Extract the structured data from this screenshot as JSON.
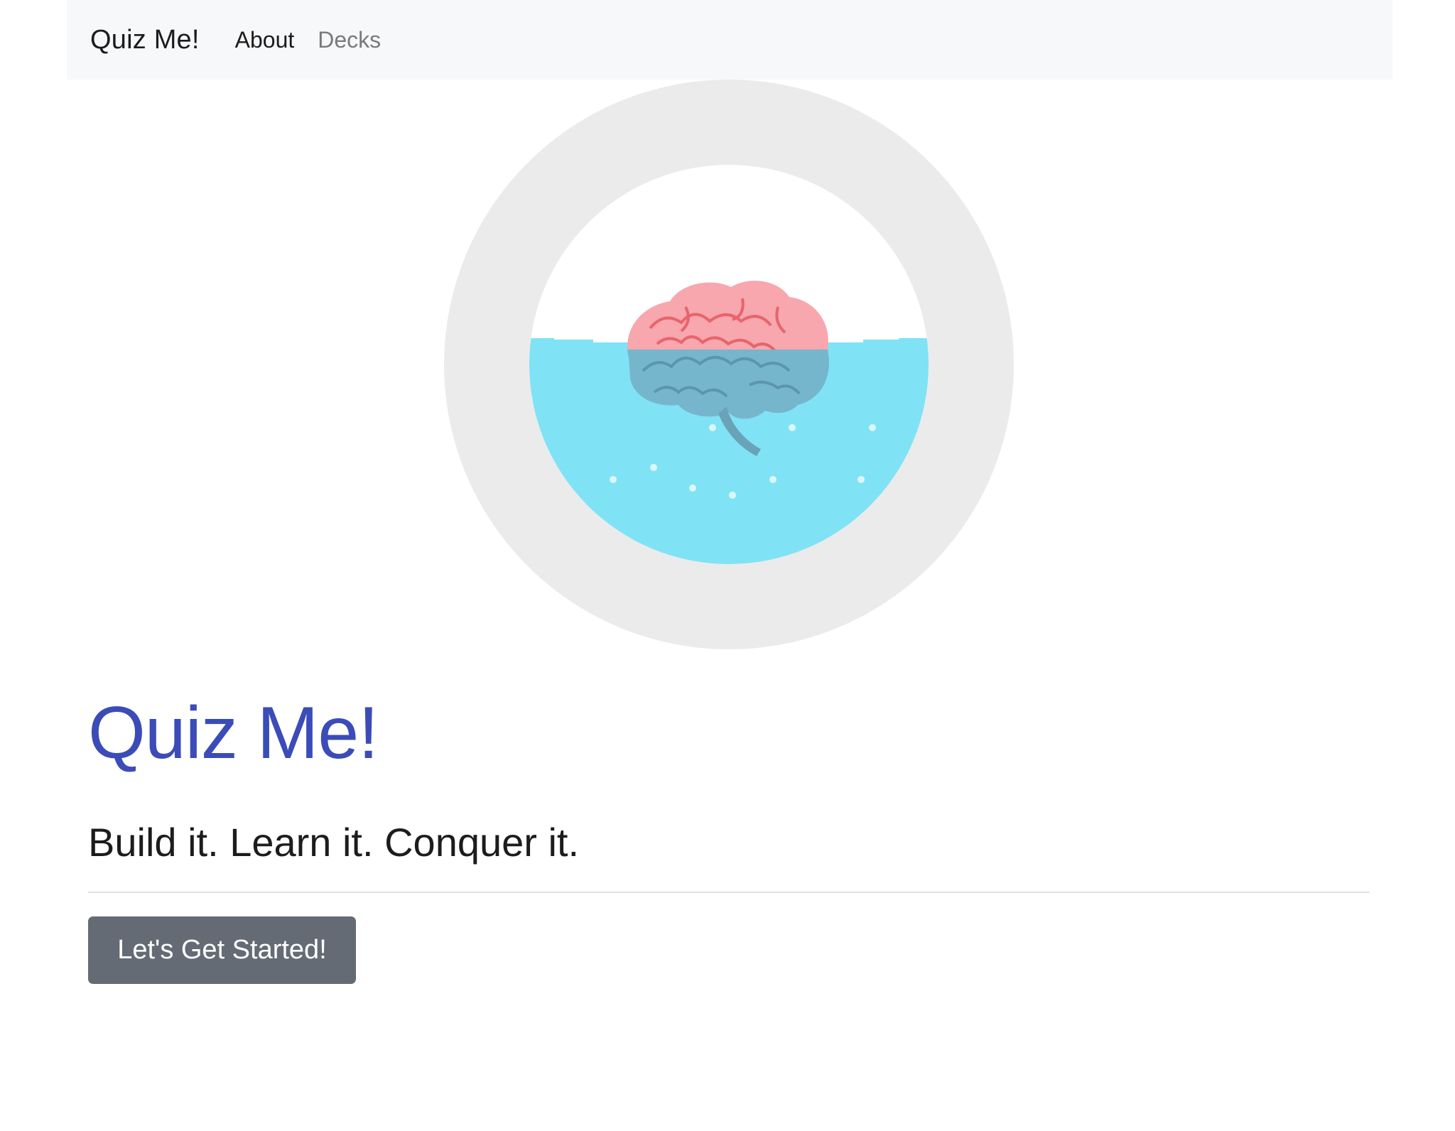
{
  "navbar": {
    "brand": "Quiz Me!",
    "links": [
      {
        "label": "About",
        "state": "active"
      },
      {
        "label": "Decks",
        "state": "inactive"
      }
    ]
  },
  "hero": {
    "title": "Quiz Me!",
    "subtitle": "Build it. Learn it. Conquer it.",
    "cta_label": "Let's Get Started!"
  },
  "colors": {
    "navbar_bg": "#f7f8f9",
    "title": "#3b4cb8",
    "button_bg": "#646b74",
    "ring": "#ebebeb",
    "water": "#80e2f5",
    "brain_top": "#f7a7ad",
    "brain_bottom": "#76b6cc"
  },
  "illustration": {
    "icon": "brain-in-water-icon"
  }
}
